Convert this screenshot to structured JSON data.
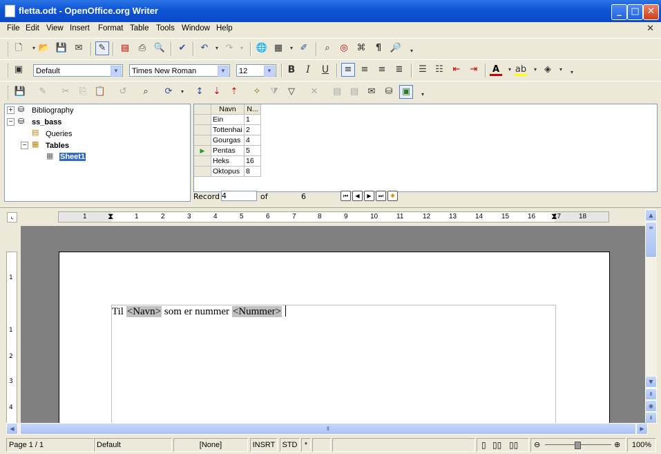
{
  "window": {
    "title": "fletta.odt - OpenOffice.org Writer"
  },
  "menu": [
    "File",
    "Edit",
    "View",
    "Insert",
    "Format",
    "Table",
    "Tools",
    "Window",
    "Help"
  ],
  "format_bar": {
    "style": "Default",
    "font": "Times New Roman",
    "size": "12"
  },
  "tree": {
    "items": [
      {
        "label": "Bibliography",
        "expander": "+"
      },
      {
        "label": "ss_bass",
        "expander": "−"
      },
      {
        "label": "Queries",
        "expander": ""
      },
      {
        "label": "Tables",
        "expander": "−"
      },
      {
        "label": "Sheet1",
        "expander": ""
      }
    ]
  },
  "grid": {
    "columns": [
      "Navn",
      "N..."
    ],
    "rows": [
      [
        "Ein",
        "1"
      ],
      [
        "Tottenhai",
        "2"
      ],
      [
        "Gourgas",
        "4"
      ],
      [
        "Pentas",
        "5"
      ],
      [
        "Heks",
        "16"
      ],
      [
        "Oktopus",
        "8"
      ]
    ],
    "current_row": 3
  },
  "record_bar": {
    "label": "Record",
    "value": "4",
    "of_label": "of",
    "total": "6"
  },
  "ruler": {
    "numbers": [
      "1",
      "1",
      "2",
      "3",
      "4",
      "5",
      "6",
      "7",
      "8",
      "9",
      "10",
      "11",
      "12",
      "13",
      "14",
      "15",
      "16",
      "17",
      "18"
    ]
  },
  "vruler": {
    "numbers": [
      "1",
      "1",
      "2",
      "3",
      "4"
    ]
  },
  "document": {
    "parts": [
      "Til ",
      "<Navn>",
      " som er nummer ",
      "<Nummer>"
    ]
  },
  "status": {
    "page": "Page 1 / 1",
    "style": "Default",
    "language": "[None]",
    "insert": "INSRT",
    "selection": "STD",
    "modified": "*",
    "zoom": "100%"
  }
}
